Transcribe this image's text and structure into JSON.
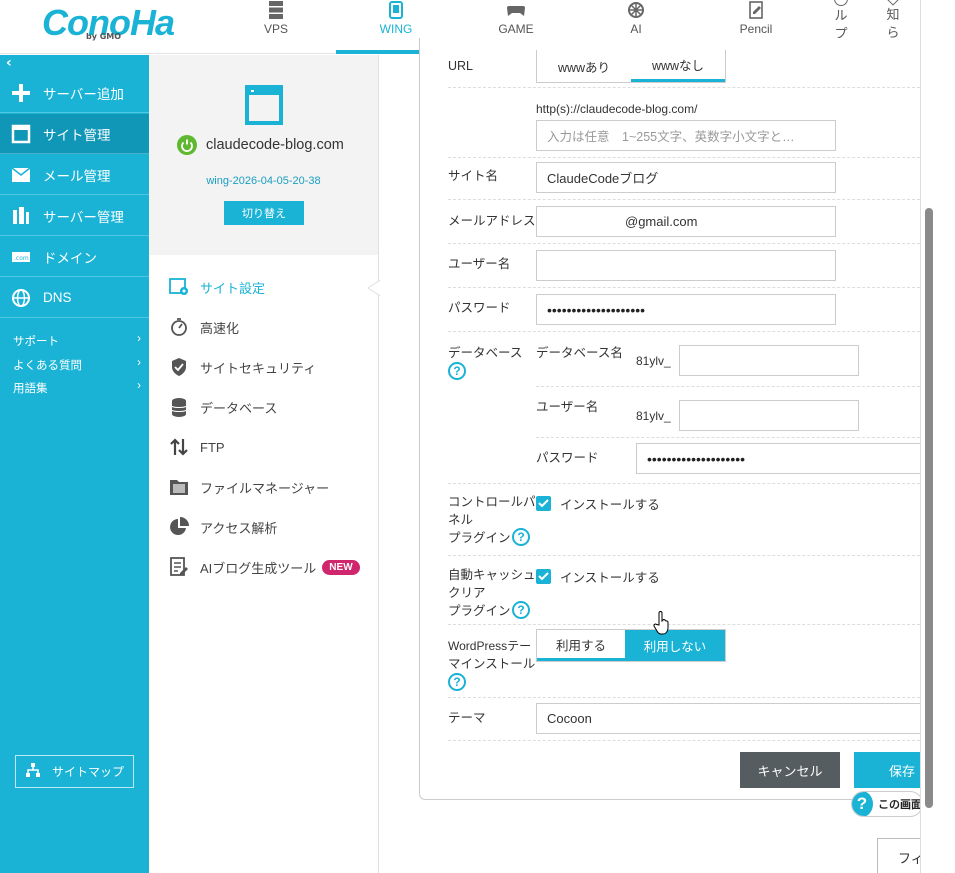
{
  "header": {
    "logo_text": "ConoHa",
    "logo_sub": "by GMO",
    "nav": [
      {
        "label": "VPS",
        "icon": "server-icon"
      },
      {
        "label": "WING",
        "icon": "wing-icon"
      },
      {
        "label": "GAME",
        "icon": "gamepad-icon"
      },
      {
        "label": "AI",
        "icon": "ai-icon"
      },
      {
        "label": "Pencil",
        "icon": "pencil-icon"
      }
    ],
    "help_vertical": "ルプ",
    "notice_vertical": "知らせ"
  },
  "sidebar": {
    "collapse": "‹",
    "items": [
      {
        "label": "サーバー追加",
        "icon": "plus-icon"
      },
      {
        "label": "サイト管理",
        "icon": "window-icon"
      },
      {
        "label": "メール管理",
        "icon": "mail-icon"
      },
      {
        "label": "サーバー管理",
        "icon": "server-manage-icon"
      },
      {
        "label": "ドメイン",
        "icon": "domain-icon"
      },
      {
        "label": "DNS",
        "icon": "globe-icon"
      }
    ],
    "links": [
      {
        "label": "サポート"
      },
      {
        "label": "よくある質問"
      },
      {
        "label": "用語集"
      }
    ],
    "sitemap": "サイトマップ"
  },
  "site": {
    "domain": "claudecode-blog.com",
    "wing_id": "wing-2026-04-05-20-38",
    "switch_label": "切り替え",
    "menu": [
      {
        "label": "サイト設定",
        "icon": "site-settings-icon"
      },
      {
        "label": "高速化",
        "icon": "speedup-icon"
      },
      {
        "label": "サイトセキュリティ",
        "icon": "shield-icon"
      },
      {
        "label": "データベース",
        "icon": "database-icon"
      },
      {
        "label": "FTP",
        "icon": "ftp-icon"
      },
      {
        "label": "ファイルマネージャー",
        "icon": "folder-icon"
      },
      {
        "label": "アクセス解析",
        "icon": "pie-chart-icon"
      },
      {
        "label": "AIブログ生成ツール",
        "icon": "ai-blog-icon",
        "badge": "NEW"
      }
    ]
  },
  "form": {
    "url_label": "URL",
    "url_options": [
      "wwwあり",
      "wwwなし"
    ],
    "url_prefix": "http(s)://claudecode-blog.com/",
    "path_placeholder": "入力は任意　1~255文字、英数字小文字と…",
    "site_name_label": "サイト名",
    "site_name_value": "ClaudeCodeブログ",
    "email_label": "メールアドレス",
    "email_value": "@gmail.com",
    "user_label": "ユーザー名",
    "user_value": "",
    "password_label": "パスワード",
    "password_value": "••••••••••••••••••••",
    "db_label": "データベース",
    "db_name_label": "データベース名",
    "db_prefix": "81ylv_",
    "db_user_label": "ユーザー名",
    "db_user_prefix": "81ylv_",
    "db_password_label": "パスワード",
    "db_password_value": "••••••••••••••••••••",
    "cp_label_1": "コントロールパ",
    "cp_label_2": "ネル",
    "cp_label_3": "プラグイン",
    "cp_check": "インストールする",
    "cache_label_1": "自動キャッシュ",
    "cache_label_2": "クリア",
    "cache_label_3": "プラグイン",
    "cache_check": "インストールする",
    "theme_install_label_1": "WordPressテー",
    "theme_install_label_2": "マインストール",
    "theme_options": [
      "利用する",
      "利用しない"
    ],
    "theme_label": "テーマ",
    "theme_value": "Cocoon",
    "help_mark": "?",
    "cancel": "キャンセル",
    "save": "保存",
    "help_float": "この画面",
    "fi_button": "フィ"
  },
  "colors": {
    "accent": "#1ab3d6",
    "badge": "#d0266d",
    "cancel": "#555d60"
  }
}
